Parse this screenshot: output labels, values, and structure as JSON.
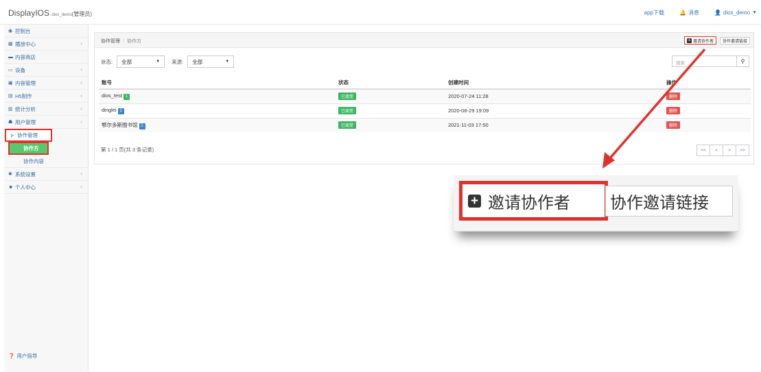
{
  "header": {
    "brand": "DisplayIOS",
    "brand_user": "dios_demo",
    "brand_role": "(管理员)",
    "nav_download": "app下载",
    "nav_messages": "消息",
    "nav_user": "dios_demo"
  },
  "sidebar": {
    "items": [
      {
        "label": "控制台",
        "icon": "dashboard-icon"
      },
      {
        "label": "播放中心",
        "icon": "grid-icon"
      },
      {
        "label": "内容商店",
        "icon": "store-icon"
      },
      {
        "label": "设备",
        "icon": "monitor-icon"
      },
      {
        "label": "内容管理",
        "icon": "content-icon"
      },
      {
        "label": "H5制作",
        "icon": "h5-icon"
      },
      {
        "label": "统计分析",
        "icon": "chart-icon"
      },
      {
        "label": "用户管理",
        "icon": "users-icon"
      },
      {
        "label": "协作管理",
        "icon": "collab-icon"
      },
      {
        "label": "协作方",
        "icon": ""
      },
      {
        "label": "协作内容",
        "icon": ""
      },
      {
        "label": "系统设置",
        "icon": "gear-icon"
      },
      {
        "label": "个人中心",
        "icon": "person-icon"
      }
    ],
    "footer": "用户指导"
  },
  "breadcrumb": {
    "parent": "协作管理",
    "sep": "/",
    "current": "协作方"
  },
  "toolbar": {
    "invite": "邀请协作者",
    "invite_link": "协作邀请链接"
  },
  "filters": {
    "status_label": "状态:",
    "status_value": "全部",
    "source_label": "来源:",
    "source_value": "全部"
  },
  "search": {
    "placeholder": "搜索"
  },
  "table": {
    "headers": [
      "账号",
      "状态",
      "创建时间",
      "操作"
    ],
    "rows": [
      {
        "account": "dios_test",
        "tag": "1",
        "status": "已接受",
        "created": "2020-07-24 11:28",
        "action": "删除"
      },
      {
        "account": "dinglei",
        "tag": "1",
        "status": "已接受",
        "created": "2020-08-29 19:09",
        "action": "删除"
      },
      {
        "account": "鄂尔多斯图书馆",
        "tag": "1",
        "status": "已接受",
        "created": "2021-11-03 17:50",
        "action": "删除"
      }
    ]
  },
  "pagination": {
    "info": "第 1 / 1 页(共 3 条记录)",
    "first": "<<",
    "prev": "<",
    "next": ">",
    "last": ">>"
  },
  "zoom": {
    "invite": "邀请协作者",
    "invite_link": "协作邀请链接"
  },
  "colors": {
    "accent": "#3a6fa0",
    "active_green": "#56c96e",
    "highlight_red": "#e0322b",
    "status_green": "#3cb763",
    "delete_red": "#e05352"
  }
}
